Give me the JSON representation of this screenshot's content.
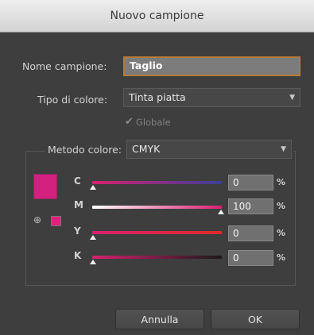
{
  "dialog": {
    "title": "Nuovo campione"
  },
  "name": {
    "label": "Nome campione:",
    "value": "Taglio"
  },
  "color_type": {
    "label": "Tipo di colore:",
    "value": "Tinta piatta"
  },
  "global": {
    "label": "Globale",
    "checked": true,
    "enabled": false
  },
  "color_mode": {
    "label": "Metodo colore:",
    "value": "CMYK"
  },
  "swatch_color": "#d2217e",
  "channels": [
    {
      "label": "C",
      "value": "0",
      "unit": "%"
    },
    {
      "label": "M",
      "value": "100",
      "unit": "%"
    },
    {
      "label": "Y",
      "value": "0",
      "unit": "%"
    },
    {
      "label": "K",
      "value": "0",
      "unit": "%"
    }
  ],
  "buttons": {
    "cancel": "Annulla",
    "ok": "OK"
  }
}
